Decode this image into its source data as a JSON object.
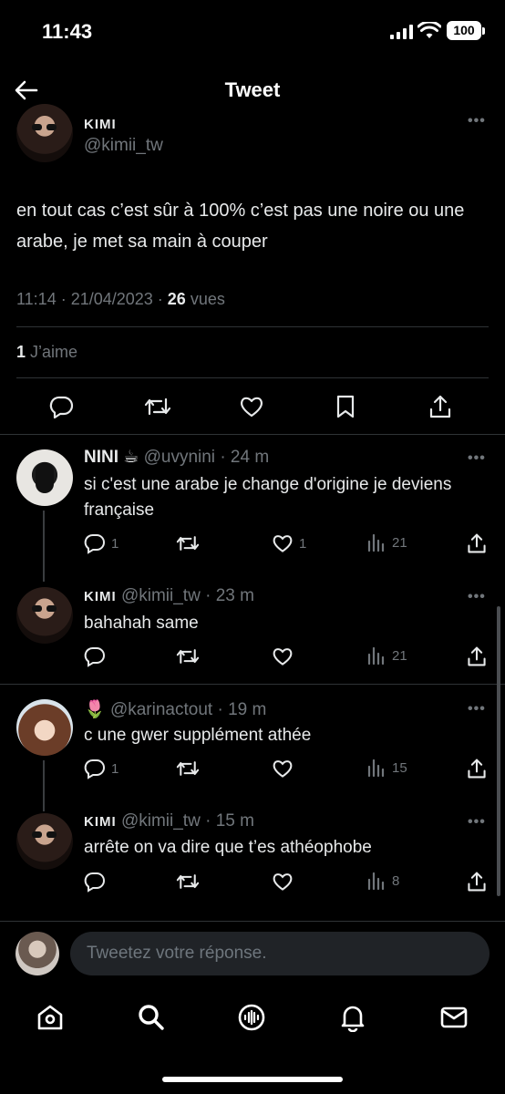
{
  "status": {
    "time": "11:43",
    "battery": "100"
  },
  "header": {
    "title": "Tweet"
  },
  "main_tweet": {
    "name": "KIMI",
    "handle": "@kimii_tw",
    "text": "en tout cas c’est sûr à 100% c’est pas une noire ou une arabe, je met sa main à couper",
    "datetime": "11:14 · 21/04/2023 · ",
    "views_count": "26",
    "views_label": " vues",
    "likes_count": "1",
    "likes_label": " J’aime"
  },
  "replies": [
    {
      "name": "NINI ☕",
      "handle": "@uvynini",
      "time": "· 24 m",
      "text": "si c'est une arabe je change d'origine je deviens française",
      "reply_count": "1",
      "like_count": "1",
      "views": "21"
    },
    {
      "name": "KIMI",
      "handle": "@kimii_tw",
      "time": "· 23 m",
      "text": "bahahah same",
      "reply_count": "",
      "like_count": "",
      "views": "21"
    },
    {
      "name": "🌷",
      "handle": "@karinactout",
      "time": "· 19 m",
      "text": "c une gwer supplément athée",
      "reply_count": "1",
      "like_count": "",
      "views": "15"
    },
    {
      "name": "KIMI",
      "handle": "@kimii_tw",
      "time": "· 15 m",
      "text": "arrête on va dire que t’es athéophobe",
      "reply_count": "",
      "like_count": "",
      "views": "8"
    }
  ],
  "composer": {
    "placeholder": "Tweetez votre réponse."
  },
  "tabs": [
    "home-icon",
    "search-icon",
    "spaces-icon",
    "notifications-icon",
    "messages-icon"
  ],
  "colors": {
    "background": "#000000",
    "text": "#e7e9ea",
    "muted": "#71767b",
    "divider": "#2f3336"
  }
}
